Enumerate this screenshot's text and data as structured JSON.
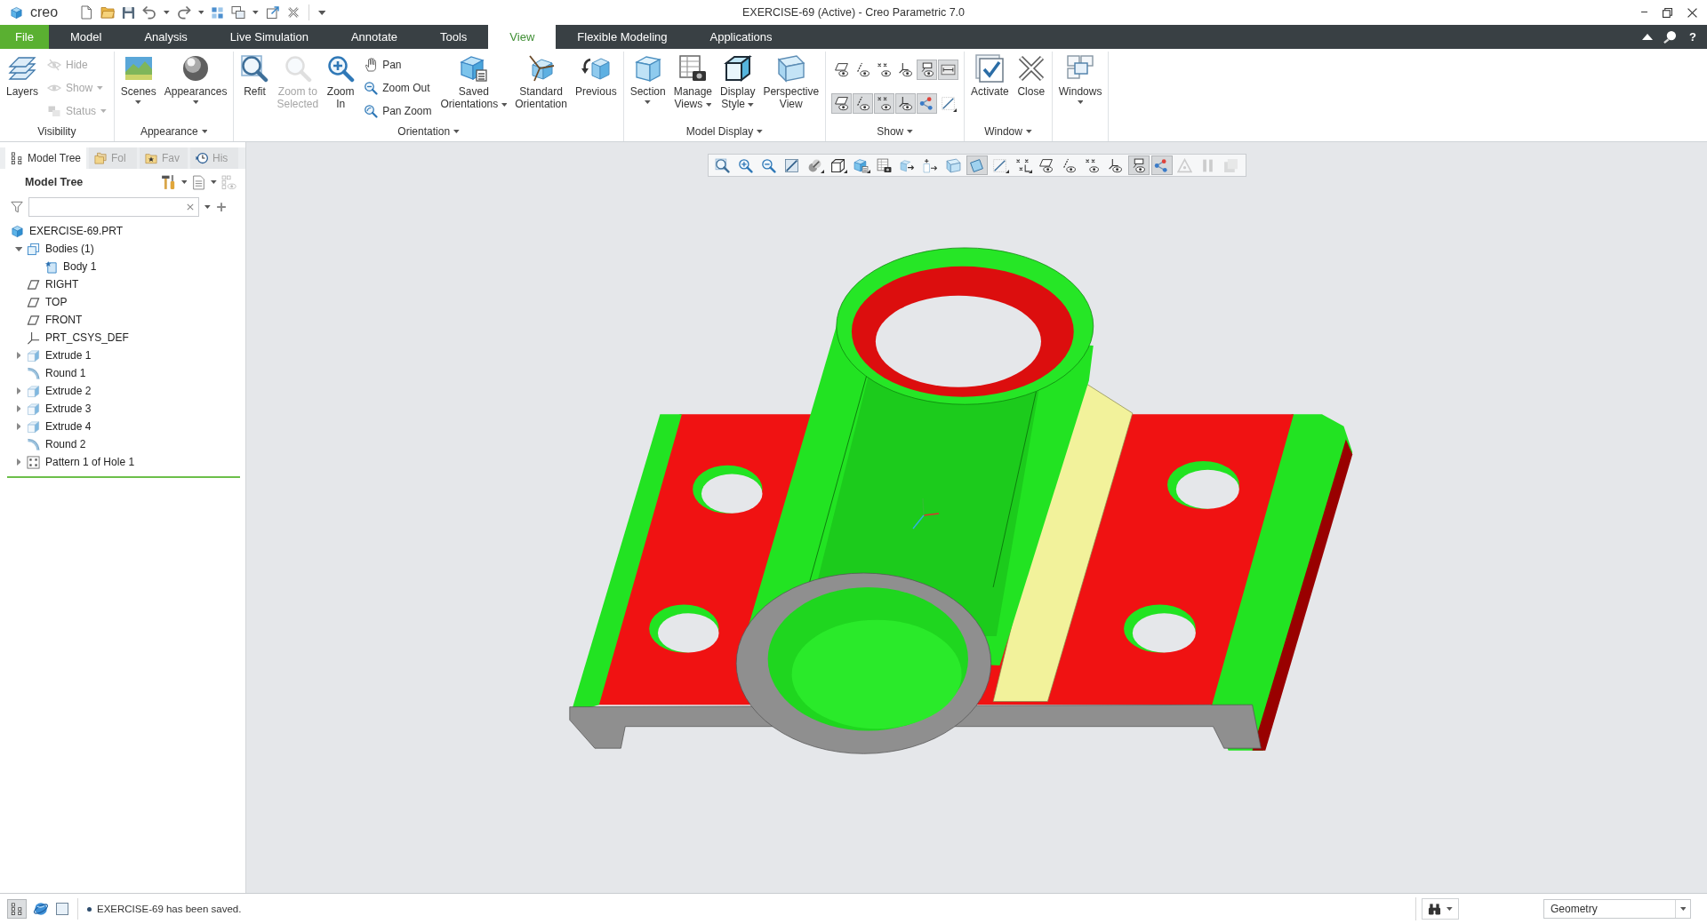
{
  "window": {
    "logo": "creo",
    "title": "EXERCISE-69 (Active) - Creo Parametric 7.0"
  },
  "ribbon_tabs": [
    {
      "label": "File",
      "kind": "file",
      "selected": false
    },
    {
      "label": "Model",
      "kind": "tab",
      "selected": false
    },
    {
      "label": "Analysis",
      "kind": "tab",
      "selected": false
    },
    {
      "label": "Live Simulation",
      "kind": "tab",
      "selected": false
    },
    {
      "label": "Annotate",
      "kind": "tab",
      "selected": false
    },
    {
      "label": "Tools",
      "kind": "tab",
      "selected": false
    },
    {
      "label": "View",
      "kind": "tab",
      "selected": true
    },
    {
      "label": "Flexible Modeling",
      "kind": "tab",
      "selected": false
    },
    {
      "label": "Applications",
      "kind": "tab",
      "selected": false
    }
  ],
  "ribbon_tools": {
    "help": "?"
  },
  "ribbon_groups": [
    {
      "label": "Visibility",
      "menu": false,
      "items": [
        {
          "kind": "large",
          "label": "Layers",
          "disabled": false,
          "menu": false
        },
        {
          "kind": "small",
          "label": "Hide",
          "disabled": true,
          "menu": false
        },
        {
          "kind": "small",
          "label": "Show",
          "disabled": true,
          "menu": true
        },
        {
          "kind": "small",
          "label": "Status",
          "disabled": true,
          "menu": true
        }
      ]
    },
    {
      "label": "Appearance",
      "menu": true,
      "items": [
        {
          "kind": "large",
          "label": "Scenes",
          "disabled": false,
          "menu": true
        },
        {
          "kind": "large",
          "label": "Appearances",
          "disabled": false,
          "menu": true
        }
      ]
    },
    {
      "label": "Orientation",
      "menu": true,
      "items": [
        {
          "kind": "large",
          "label": "Refit",
          "disabled": false,
          "menu": false
        },
        {
          "kind": "large",
          "label": "Zoom to\nSelected",
          "disabled": true,
          "menu": false
        },
        {
          "kind": "large",
          "label": "Zoom\nIn",
          "disabled": false,
          "menu": false
        },
        {
          "kind": "small",
          "label": "Pan",
          "disabled": false,
          "menu": false
        },
        {
          "kind": "small",
          "label": "Zoom Out",
          "disabled": false,
          "menu": false
        },
        {
          "kind": "small",
          "label": "Pan Zoom",
          "disabled": false,
          "menu": false
        },
        {
          "kind": "large",
          "label": "Saved\nOrientations",
          "disabled": false,
          "menu": true
        },
        {
          "kind": "large",
          "label": "Standard\nOrientation",
          "disabled": false,
          "menu": false
        },
        {
          "kind": "large",
          "label": "Previous",
          "disabled": false,
          "menu": false
        }
      ]
    },
    {
      "label": "Model Display",
      "menu": true,
      "items": [
        {
          "kind": "large",
          "label": "Section",
          "disabled": false,
          "menu": true
        },
        {
          "kind": "large",
          "label": "Manage\nViews",
          "disabled": false,
          "menu": true
        },
        {
          "kind": "large",
          "label": "Display\nStyle",
          "disabled": false,
          "menu": true
        },
        {
          "kind": "large",
          "label": "Perspective\nView",
          "disabled": false,
          "menu": false
        }
      ]
    },
    {
      "label": "Show",
      "menu": true,
      "items": [
        {
          "kind": "grid",
          "rows": [
            [
              {
                "on": false,
                "menu": false
              },
              {
                "on": false,
                "menu": false
              },
              {
                "on": false,
                "menu": false
              },
              {
                "on": false,
                "menu": false
              },
              {
                "on": true,
                "menu": false
              },
              {
                "on": true,
                "menu": false
              }
            ],
            [
              {
                "on": true,
                "menu": false
              },
              {
                "on": true,
                "menu": false
              },
              {
                "on": true,
                "menu": false
              },
              {
                "on": true,
                "menu": false
              },
              {
                "on": true,
                "menu": false
              },
              {
                "on": false,
                "menu": true
              }
            ]
          ]
        }
      ]
    },
    {
      "label": "Window",
      "menu": true,
      "items": [
        {
          "kind": "large",
          "label": "Activate",
          "disabled": false,
          "menu": false
        },
        {
          "kind": "large",
          "label": "Close",
          "disabled": false,
          "menu": false
        }
      ]
    },
    {
      "items": [
        {
          "kind": "large",
          "label": "Windows",
          "disabled": false,
          "menu": true
        }
      ]
    }
  ],
  "view_toolbar": [
    {
      "on": false,
      "menu": false,
      "disabled": false
    },
    {
      "on": false,
      "menu": false,
      "disabled": false
    },
    {
      "on": false,
      "menu": false,
      "disabled": false
    },
    {
      "on": false,
      "menu": false,
      "disabled": false
    },
    {
      "on": false,
      "menu": true,
      "disabled": false
    },
    {
      "on": false,
      "menu": true,
      "disabled": false
    },
    {
      "on": false,
      "menu": true,
      "disabled": false
    },
    {
      "on": false,
      "menu": false,
      "disabled": false
    },
    {
      "on": false,
      "menu": false,
      "disabled": false
    },
    {
      "on": false,
      "menu": false,
      "disabled": false
    },
    {
      "on": false,
      "menu": false,
      "disabled": false
    },
    {
      "on": true,
      "menu": false,
      "disabled": false
    },
    {
      "on": false,
      "menu": true,
      "disabled": false
    },
    {
      "on": false,
      "menu": true,
      "disabled": false
    },
    {
      "on": false,
      "menu": false,
      "disabled": false
    },
    {
      "on": false,
      "menu": false,
      "disabled": false
    },
    {
      "on": false,
      "menu": false,
      "disabled": false
    },
    {
      "on": false,
      "menu": false,
      "disabled": false
    },
    {
      "on": true,
      "menu": false,
      "disabled": false
    },
    {
      "on": true,
      "menu": false,
      "disabled": false
    },
    {
      "on": false,
      "menu": false,
      "disabled": true
    },
    {
      "on": false,
      "menu": false,
      "disabled": true
    },
    {
      "on": false,
      "menu": false,
      "disabled": true
    }
  ],
  "navigator": {
    "tabs": [
      {
        "label": "Model Tree",
        "selected": true
      },
      {
        "label": "Fol",
        "selected": false
      },
      {
        "label": "Fav",
        "selected": false
      },
      {
        "label": "His",
        "selected": false
      }
    ],
    "title": "Model Tree",
    "tree": [
      {
        "label": "EXERCISE-69.PRT",
        "kind": "part",
        "children": [
          {
            "label": "Bodies (1)",
            "kind": "bodies",
            "expanded": true,
            "children": [
              {
                "label": "Body 1",
                "kind": "body"
              }
            ]
          },
          {
            "label": "RIGHT",
            "kind": "plane"
          },
          {
            "label": "TOP",
            "kind": "plane"
          },
          {
            "label": "FRONT",
            "kind": "plane"
          },
          {
            "label": "PRT_CSYS_DEF",
            "kind": "csys"
          },
          {
            "label": "Extrude 1",
            "kind": "extrude",
            "expanded": false
          },
          {
            "label": "Round 1",
            "kind": "round"
          },
          {
            "label": "Extrude 2",
            "kind": "extrude",
            "expanded": false
          },
          {
            "label": "Extrude 3",
            "kind": "extrude",
            "expanded": false
          },
          {
            "label": "Extrude 4",
            "kind": "extrude",
            "expanded": false
          },
          {
            "label": "Round 2",
            "kind": "round"
          },
          {
            "label": "Pattern 1 of Hole 1",
            "kind": "pattern",
            "expanded": false
          }
        ]
      }
    ]
  },
  "status_bar": {
    "tree_toggle": {
      "on": true
    },
    "message": "EXERCISE-69 has been saved.",
    "selection_filter": "Geometry"
  }
}
